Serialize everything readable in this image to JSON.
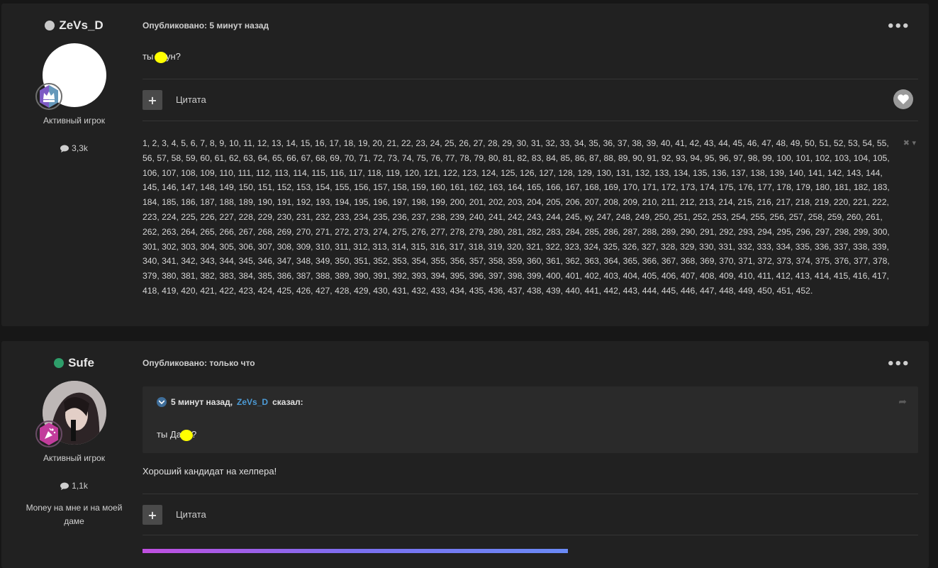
{
  "posts": [
    {
      "author": {
        "name": "ZeVs_D",
        "status_color": "#c9c9c9",
        "rank": "Активный игрок",
        "posts_count": "3,3k"
      },
      "meta": {
        "label": "Опубликовано:",
        "time": "5 минут назад"
      },
      "content": {
        "text_before": "ты",
        "text_after": "ун?"
      },
      "actions": {
        "quote": "Цитата"
      },
      "signature_numbers": "1, 2, 3, 4, 5, 6, 7, 8, 9, 10, 11, 12, 13, 14, 15, 16, 17, 18, 19, 20, 21, 22, 23, 24, 25, 26, 27, 28, 29, 30, 31, 32, 33, 34, 35, 36, 37, 38, 39, 40, 41, 42, 43, 44, 45, 46, 47, 48, 49, 50, 51, 52, 53, 54, 55, 56, 57, 58, 59, 60, 61, 62, 63, 64, 65, 66, 67, 68, 69, 70, 71, 72, 73, 74, 75, 76, 77, 78, 79, 80, 81, 82, 83, 84, 85, 86, 87, 88, 89, 90, 91, 92, 93, 94, 95, 96, 97, 98, 99, 100, 101, 102, 103, 104, 105, 106, 107, 108, 109, 110, 111, 112, 113, 114, 115, 116, 117, 118, 119, 120, 121, 122, 123, 124, 125, 126, 127, 128, 129, 130, 131, 132, 133, 134, 135, 136, 137, 138, 139, 140, 141, 142, 143, 144, 145, 146, 147, 148, 149, 150, 151, 152, 153, 154, 155, 156, 157, 158, 159, 160, 161, 162, 163, 164, 165, 166, 167, 168, 169, 170, 171, 172, 173, 174, 175, 176, 177, 178, 179, 180, 181, 182, 183, 184, 185, 186, 187, 188, 189, 190, 191, 192, 193, 194, 195, 196, 197, 198, 199, 200, 201, 202, 203, 204, 205, 206, 207, 208, 209, 210, 211, 212, 213, 214, 215, 216, 217, 218, 219, 220, 221, 222, 223, 224, 225, 226, 227, 228, 229, 230, 231, 232, 233, 234, 235, 236, 237, 238, 239, 240, 241, 242, 243, 244, 245, ку, 247, 248, 249, 250, 251, 252, 253, 254, 255, 256, 257, 258, 259, 260, 261, 262, 263, 264, 265, 266, 267, 268, 269, 270, 271, 272, 273, 274, 275, 276, 277, 278, 279, 280, 281, 282, 283, 284, 285, 286, 287, 288, 289, 290, 291, 292, 293, 294, 295, 296, 297, 298, 299, 300, 301, 302, 303, 304, 305, 306, 307, 308, 309, 310, 311, 312, 313, 314, 315, 316, 317, 318, 319, 320, 321, 322, 323, 324, 325, 326, 327, 328, 329, 330, 331, 332, 333, 334, 335, 336, 337, 338, 339, 340, 341, 342, 343, 344, 345, 346, 347, 348, 349, 350, 351, 352, 353, 354, 355, 356, 357, 358, 359, 360, 361, 362, 363, 364, 365, 366, 367, 368, 369, 370, 371, 372, 373, 374, 375, 376, 377, 378, 379, 380, 381, 382, 383, 384, 385, 386, 387, 388, 389, 390, 391, 392, 393, 394, 395, 396, 397, 398, 399, 400, 401, 402, 403, 404, 405, 406, 407, 408, 409, 410, 411, 412, 413, 414, 415, 416, 417, 418, 419, 420, 421, 422, 423, 424, 425, 426, 427, 428, 429, 430, 431, 432, 433, 434, 435, 436, 437, 438, 439, 440, 441, 442, 443, 444, 445, 446, 447, 448, 449, 450, 451, 452."
    },
    {
      "author": {
        "name": "Sufe",
        "status_color": "#2e9e6a",
        "rank": "Активный игрок",
        "posts_count": "1,1k",
        "signature": "Money на мне и на моей даме"
      },
      "meta": {
        "label": "Опубликовано:",
        "time": "только что"
      },
      "quote": {
        "time": "5 минут назад,",
        "author": "ZeVs_D",
        "said": "сказал:",
        "text_before": "ты Да",
        "text_after": "?"
      },
      "content": {
        "text": "Хороший кандидат на хелпера!"
      },
      "actions": {
        "quote": "Цитата"
      }
    }
  ],
  "icons": {
    "more": "more-dots-icon",
    "plus": "plus-icon",
    "heart": "heart-icon",
    "comment": "comment-icon",
    "rank_badge": "crown-icon",
    "quote_toggle": "chevron-down-icon",
    "share": "share-icon"
  },
  "colors": {
    "background": "#171717",
    "panel": "#212121",
    "link": "#4c9bd6",
    "highlight": "#ffff00"
  }
}
